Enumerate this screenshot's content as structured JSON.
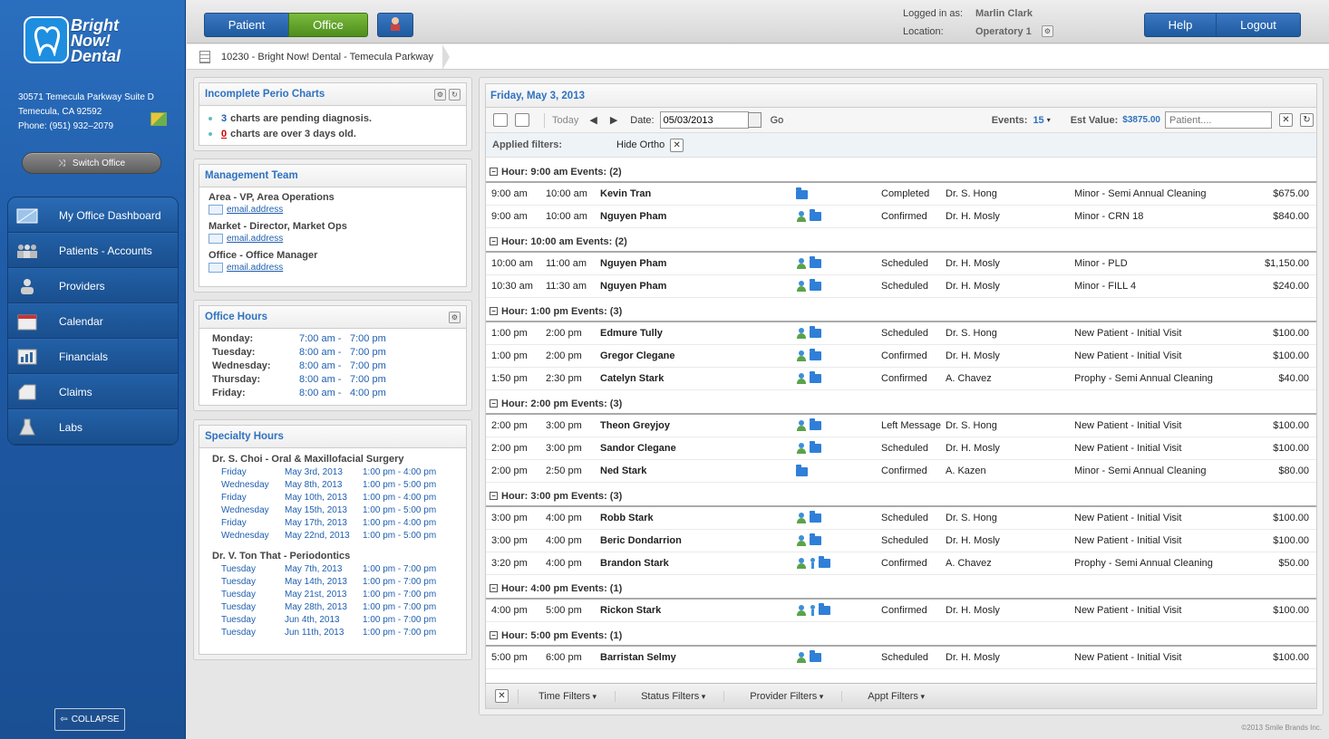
{
  "brand": {
    "line1": "Bright",
    "line2": "Now!",
    "line3": "Dental"
  },
  "office_address": {
    "street": "30571 Temecula Parkway Suite D",
    "city": "Temecula, CA 92592",
    "phone": "Phone: (951) 932–2079"
  },
  "switch_office_label": "Switch Office",
  "nav": [
    {
      "label": "My Office Dashboard"
    },
    {
      "label": "Patients - Accounts"
    },
    {
      "label": "Providers"
    },
    {
      "label": "Calendar"
    },
    {
      "label": "Financials"
    },
    {
      "label": "Claims"
    },
    {
      "label": "Labs"
    }
  ],
  "collapse_label": "COLLAPSE",
  "topbar": {
    "patient_tab": "Patient",
    "office_tab": "Office",
    "logged_in_label": "Logged in as:",
    "logged_in_value": "Marlin Clark",
    "location_label": "Location:",
    "location_value": "Operatory 1",
    "help": "Help",
    "logout": "Logout"
  },
  "breadcrumb": "10230 - Bright Now! Dental - Temecula Parkway",
  "perio": {
    "title": "Incomplete Perio Charts",
    "pending_count": "3",
    "pending_text": "charts are pending diagnosis.",
    "overdue_count": "0",
    "overdue_text": "charts are over 3 days old."
  },
  "management": {
    "title": "Management Team",
    "members": [
      {
        "role": "Area - VP, Area Operations",
        "email": "email.address"
      },
      {
        "role": "Market - Director, Market Ops",
        "email": "email.address"
      },
      {
        "role": "Office - Office Manager",
        "email": "email.address"
      }
    ]
  },
  "office_hours": {
    "title": "Office Hours",
    "days": [
      {
        "day": "Monday:",
        "open": "7:00 am -",
        "close": "7:00 pm"
      },
      {
        "day": "Tuesday:",
        "open": "8:00 am -",
        "close": "7:00 pm"
      },
      {
        "day": "Wednesday:",
        "open": "8:00 am -",
        "close": "7:00 pm"
      },
      {
        "day": "Thursday:",
        "open": "8:00 am -",
        "close": "7:00 pm"
      },
      {
        "day": "Friday:",
        "open": "8:00 am -",
        "close": "4:00 pm"
      }
    ]
  },
  "specialty": {
    "title": "Specialty Hours",
    "doctors": [
      {
        "name": "Dr. S. Choi - Oral & Maxillofacial Surgery",
        "rows": [
          [
            "Friday",
            "May 3rd, 2013",
            "1:00 pm - 4:00 pm"
          ],
          [
            "Wednesday",
            "May 8th, 2013",
            "1:00 pm - 5:00 pm"
          ],
          [
            "Friday",
            "May 10th, 2013",
            "1:00 pm - 4:00 pm"
          ],
          [
            "Wednesday",
            "May 15th, 2013",
            "1:00 pm - 5:00 pm"
          ],
          [
            "Friday",
            "May 17th, 2013",
            "1:00 pm - 4:00 pm"
          ],
          [
            "Wednesday",
            "May 22nd, 2013",
            "1:00 pm - 5:00 pm"
          ]
        ]
      },
      {
        "name": "Dr. V. Ton That - Periodontics",
        "rows": [
          [
            "Tuesday",
            "May 7th, 2013",
            "1:00 pm - 7:00 pm"
          ],
          [
            "Tuesday",
            "May 14th, 2013",
            "1:00 pm - 7:00 pm"
          ],
          [
            "Tuesday",
            "May 21st, 2013",
            "1:00 pm - 7:00 pm"
          ],
          [
            "Tuesday",
            "May 28th, 2013",
            "1:00 pm - 7:00 pm"
          ],
          [
            "Tuesday",
            "Jun 4th, 2013",
            "1:00 pm - 7:00 pm"
          ],
          [
            "Tuesday",
            "Jun 11th, 2013",
            "1:00 pm - 7:00 pm"
          ]
        ]
      }
    ]
  },
  "schedule": {
    "title": "Friday, May 3, 2013",
    "today": "Today",
    "date_label": "Date:",
    "date_value": "05/03/2013",
    "go": "Go",
    "events_label": "Events:",
    "events_value": "15",
    "est_label": "Est Value:",
    "est_value": "$3875.00",
    "patient_placeholder": "Patient....",
    "applied_filters_label": "Applied filters:",
    "applied_filter": "Hide Ortho",
    "groups": [
      {
        "header": "Hour: 9:00 am Events: (2)",
        "rows": [
          {
            "start": "9:00 am",
            "end": "10:00 am",
            "patient": "Kevin Tran",
            "icons": [
              "folder"
            ],
            "status": "Completed",
            "provider": "Dr. S. Hong",
            "proc": "Minor - Semi Annual Cleaning",
            "amount": "$675.00"
          },
          {
            "start": "9:00 am",
            "end": "10:00 am",
            "patient": "Nguyen Pham",
            "icons": [
              "person",
              "folder"
            ],
            "status": "Confirmed",
            "provider": "Dr. H. Mosly",
            "proc": "Minor - CRN 18",
            "amount": "$840.00"
          }
        ]
      },
      {
        "header": "Hour: 10:00 am Events: (2)",
        "rows": [
          {
            "start": "10:00 am",
            "end": "11:00 am",
            "patient": "Nguyen Pham",
            "icons": [
              "person",
              "folder"
            ],
            "status": "Scheduled",
            "provider": "Dr. H. Mosly",
            "proc": "Minor - PLD",
            "amount": "$1,150.00"
          },
          {
            "start": "10:30 am",
            "end": "11:30 am",
            "patient": "Nguyen Pham",
            "icons": [
              "person",
              "folder"
            ],
            "status": "Scheduled",
            "provider": "Dr. H. Mosly",
            "proc": "Minor - FILL 4",
            "amount": "$240.00"
          }
        ]
      },
      {
        "header": "Hour: 1:00 pm Events: (3)",
        "rows": [
          {
            "start": "1:00 pm",
            "end": "2:00 pm",
            "patient": "Edmure Tully",
            "icons": [
              "person",
              "folder"
            ],
            "status": "Scheduled",
            "provider": "Dr. S. Hong",
            "proc": "New Patient - Initial Visit",
            "amount": "$100.00"
          },
          {
            "start": "1:00 pm",
            "end": "2:00 pm",
            "patient": "Gregor Clegane",
            "icons": [
              "person",
              "folder"
            ],
            "status": "Confirmed",
            "provider": "Dr. H. Mosly",
            "proc": "New Patient - Initial Visit",
            "amount": "$100.00"
          },
          {
            "start": "1:50 pm",
            "end": "2:30 pm",
            "patient": "Catelyn Stark",
            "icons": [
              "person",
              "folder"
            ],
            "status": "Confirmed",
            "provider": "A. Chavez",
            "proc": "Prophy - Semi Annual Cleaning",
            "amount": "$40.00"
          }
        ]
      },
      {
        "header": "Hour: 2:00 pm Events: (3)",
        "rows": [
          {
            "start": "2:00 pm",
            "end": "3:00 pm",
            "patient": "Theon Greyjoy",
            "icons": [
              "person",
              "folder"
            ],
            "status": "Left Message",
            "provider": "Dr. S. Hong",
            "proc": "New Patient - Initial Visit",
            "amount": "$100.00"
          },
          {
            "start": "2:00 pm",
            "end": "3:00 pm",
            "patient": "Sandor Clegane",
            "icons": [
              "person",
              "folder"
            ],
            "status": "Scheduled",
            "provider": "Dr. H. Mosly",
            "proc": "New Patient - Initial Visit",
            "amount": "$100.00"
          },
          {
            "start": "2:00 pm",
            "end": "2:50 pm",
            "patient": "Ned Stark",
            "icons": [
              "folder"
            ],
            "status": "Confirmed",
            "provider": "A. Kazen",
            "proc": "Minor - Semi Annual Cleaning",
            "amount": "$80.00"
          }
        ]
      },
      {
        "header": "Hour: 3:00 pm Events: (3)",
        "rows": [
          {
            "start": "3:00 pm",
            "end": "4:00 pm",
            "patient": "Robb Stark",
            "icons": [
              "person",
              "folder"
            ],
            "status": "Scheduled",
            "provider": "Dr. S. Hong",
            "proc": "New Patient - Initial Visit",
            "amount": "$100.00"
          },
          {
            "start": "3:00 pm",
            "end": "4:00 pm",
            "patient": "Beric Dondarrion",
            "icons": [
              "person",
              "folder"
            ],
            "status": "Scheduled",
            "provider": "Dr. H. Mosly",
            "proc": "New Patient - Initial Visit",
            "amount": "$100.00"
          },
          {
            "start": "3:20 pm",
            "end": "4:00 pm",
            "patient": "Brandon Stark",
            "icons": [
              "person",
              "child",
              "folder"
            ],
            "status": "Confirmed",
            "provider": "A. Chavez",
            "proc": "Prophy - Semi Annual Cleaning",
            "amount": "$50.00"
          }
        ]
      },
      {
        "header": "Hour: 4:00 pm Events: (1)",
        "rows": [
          {
            "start": "4:00 pm",
            "end": "5:00 pm",
            "patient": "Rickon Stark",
            "icons": [
              "person",
              "child",
              "folder"
            ],
            "status": "Confirmed",
            "provider": "Dr. H. Mosly",
            "proc": "New Patient - Initial Visit",
            "amount": "$100.00"
          }
        ]
      },
      {
        "header": "Hour: 5:00 pm Events: (1)",
        "rows": [
          {
            "start": "5:00 pm",
            "end": "6:00 pm",
            "patient": "Barristan Selmy",
            "icons": [
              "person",
              "folder"
            ],
            "status": "Scheduled",
            "provider": "Dr. H. Mosly",
            "proc": "New Patient - Initial Visit",
            "amount": "$100.00"
          }
        ]
      }
    ],
    "footer_filters": [
      "Time Filters",
      "Status Filters",
      "Provider Filters",
      "Appt Filters"
    ]
  },
  "copyright": "©2013 Smile Brands Inc."
}
